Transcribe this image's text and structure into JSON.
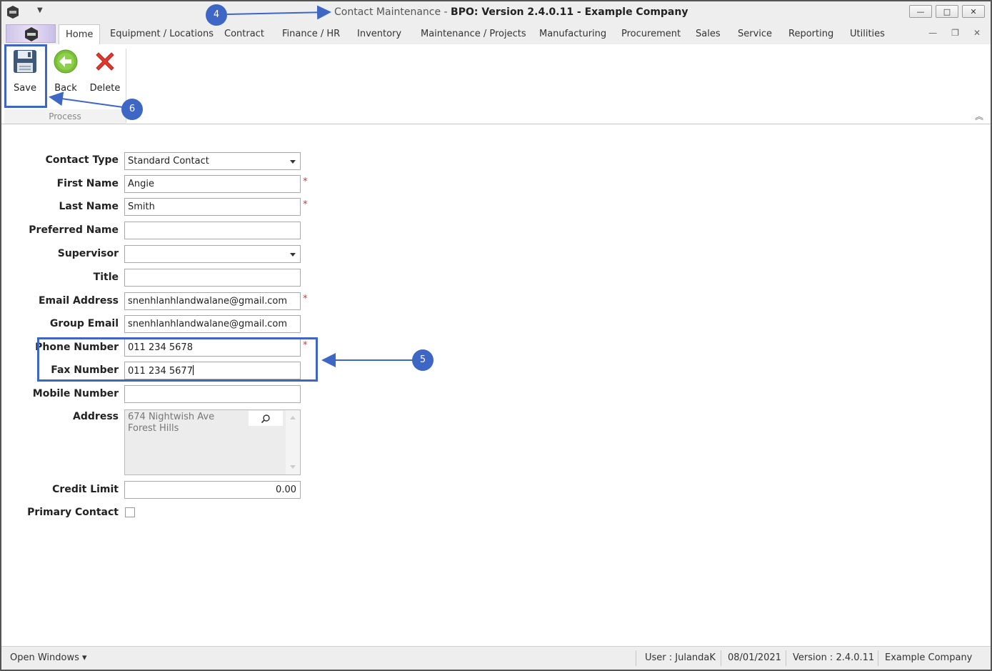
{
  "window": {
    "title_prefix": "Contact Maintenance",
    "title_separator": " - ",
    "title_main": "BPO: Version 2.4.0.11 - Example Company",
    "controls": {
      "minimize": "—",
      "maximize": "□",
      "close": "✕"
    },
    "mdi_controls": {
      "minimize": "—",
      "restore": "❐",
      "close": "✕"
    }
  },
  "tabs": [
    {
      "label": "Home",
      "active": true
    },
    {
      "label": "Equipment / Locations"
    },
    {
      "label": "Contract"
    },
    {
      "label": "Finance / HR"
    },
    {
      "label": "Inventory"
    },
    {
      "label": "Maintenance / Projects"
    },
    {
      "label": "Manufacturing"
    },
    {
      "label": "Procurement"
    },
    {
      "label": "Sales"
    },
    {
      "label": "Service"
    },
    {
      "label": "Reporting"
    },
    {
      "label": "Utilities"
    }
  ],
  "ribbon": {
    "buttons": [
      {
        "label": "Save",
        "icon": "floppy-disk-icon"
      },
      {
        "label": "Back",
        "icon": "back-arrow-icon"
      },
      {
        "label": "Delete",
        "icon": "red-x-icon"
      }
    ],
    "group_label": "Process"
  },
  "form": {
    "contact_type": {
      "label": "Contact Type",
      "value": "Standard Contact"
    },
    "first_name": {
      "label": "First Name",
      "value": "Angie",
      "required": true
    },
    "last_name": {
      "label": "Last Name",
      "value": "Smith",
      "required": true
    },
    "preferred_name": {
      "label": "Preferred Name",
      "value": ""
    },
    "supervisor": {
      "label": "Supervisor",
      "value": ""
    },
    "title": {
      "label": "Title",
      "value": ""
    },
    "email": {
      "label": "Email Address",
      "value": "snenhlanhlandwalane@gmail.com",
      "required": true
    },
    "group_email": {
      "label": "Group Email",
      "value": "snenhlanhlandwalane@gmail.com"
    },
    "phone": {
      "label": "Phone Number",
      "value": "011 234 5678",
      "required": true
    },
    "fax": {
      "label": "Fax Number",
      "value": "011 234 5677"
    },
    "mobile": {
      "label": "Mobile Number",
      "value": ""
    },
    "address": {
      "label": "Address",
      "line1": "674 Nightwish Ave",
      "line2": "Forest Hills"
    },
    "credit_limit": {
      "label": "Credit Limit",
      "value": "0.00"
    },
    "primary_contact": {
      "label": "Primary Contact",
      "checked": false
    },
    "required_marker": "*"
  },
  "annotations": {
    "badge_4": "4",
    "badge_5": "5",
    "badge_6": "6",
    "color": "#3d66c5"
  },
  "statusbar": {
    "open_windows": "Open Windows ▾",
    "user": "User : JulandaK",
    "date": "08/01/2021",
    "version": "Version : 2.4.0.11",
    "company": "Example Company"
  }
}
